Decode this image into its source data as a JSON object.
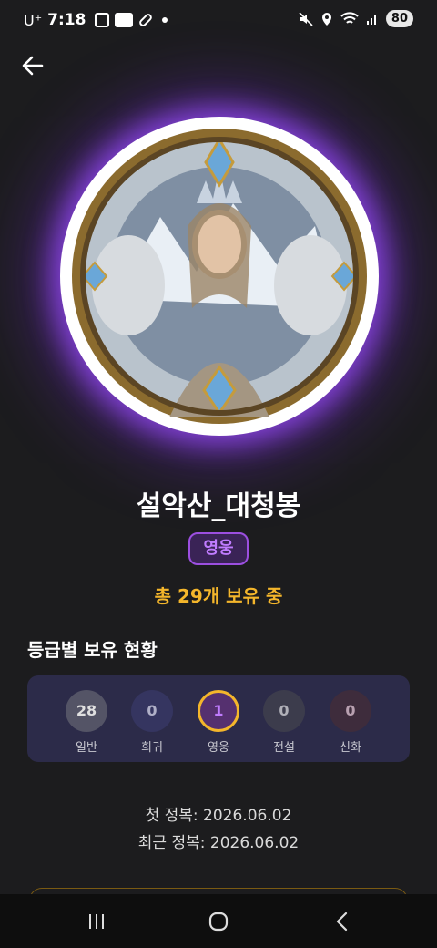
{
  "status_bar": {
    "carrier": "U⁺",
    "time": "7:18",
    "battery": "80"
  },
  "profile": {
    "name": "설악산_대청봉",
    "grade_badge": "영웅",
    "owned_text": "총 29개 보유 중"
  },
  "grade_section": {
    "title": "등급별 보유 현황",
    "grades": [
      {
        "label": "일반",
        "count": "28",
        "color": "#4a4a5a"
      },
      {
        "label": "희귀",
        "count": "0",
        "color": "#353560"
      },
      {
        "label": "영웅",
        "count": "1",
        "color": "#55306f",
        "selected": true
      },
      {
        "label": "전설",
        "count": "0",
        "color": "#3c3c4c"
      },
      {
        "label": "신화",
        "count": "0",
        "color": "#3e2c3c"
      }
    ]
  },
  "dates": {
    "first_capture": "첫 정복: 2026.06.02",
    "latest_capture": "최근 정복: 2026.06.02"
  },
  "colors": {
    "accent_purple": "#9c4fe0",
    "accent_gold": "#f4b62b",
    "background": "#1c1c1e"
  },
  "icons": {
    "back": "arrow-left-icon",
    "nav_recent": "recent-apps-icon",
    "nav_home": "home-icon",
    "nav_back": "nav-back-icon"
  }
}
